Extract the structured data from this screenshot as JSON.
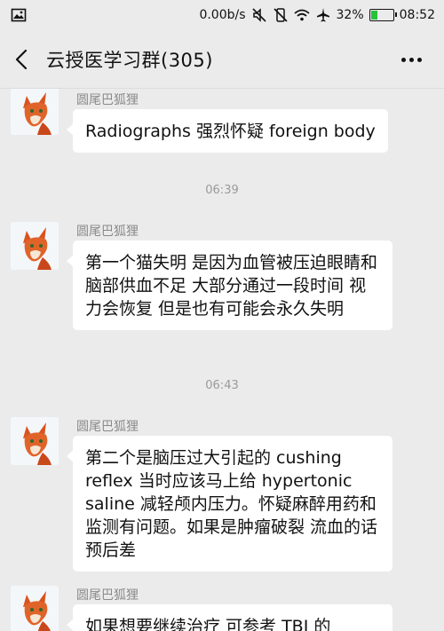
{
  "status_bar": {
    "speed": "0.00b/s",
    "battery": "32%",
    "battery_level": 0.32,
    "time": "08:52",
    "icons": [
      "image-icon",
      "mute-icon",
      "vibrate-icon",
      "wifi-icon",
      "airplane-icon",
      "battery-icon"
    ]
  },
  "header": {
    "title": "云授医学习群(305)",
    "back_icon": "chevron-left-icon",
    "more_icon": "more-dots-icon"
  },
  "messages": [
    {
      "sender": "圆尾巴狐狸",
      "text": "Radiographs 强烈怀疑 foreign body"
    },
    {
      "timestamp": "06:39"
    },
    {
      "sender": "圆尾巴狐狸",
      "text": "第一个猫失明 是因为血管被压迫眼睛和脑部供血不足 大部分通过一段时间 视力会恢复 但是也有可能会永久失明"
    },
    {
      "timestamp": "06:43"
    },
    {
      "sender": "圆尾巴狐狸",
      "text": "第二个是脑压过大引起的 cushing reflex 当时应该马上给 hypertonic saline 减轻颅内压力。怀疑麻醉用药和监测有问题。如果是肿瘤破裂 流血的话 预后差"
    },
    {
      "sender": "圆尾巴狐狸",
      "text": "如果想要继续治疗 可参考 TBI 的"
    }
  ],
  "colors": {
    "background": "#ebebeb",
    "bubble": "#ffffff",
    "battery_green": "#27c13a",
    "meta_text": "#8a8a8a"
  }
}
